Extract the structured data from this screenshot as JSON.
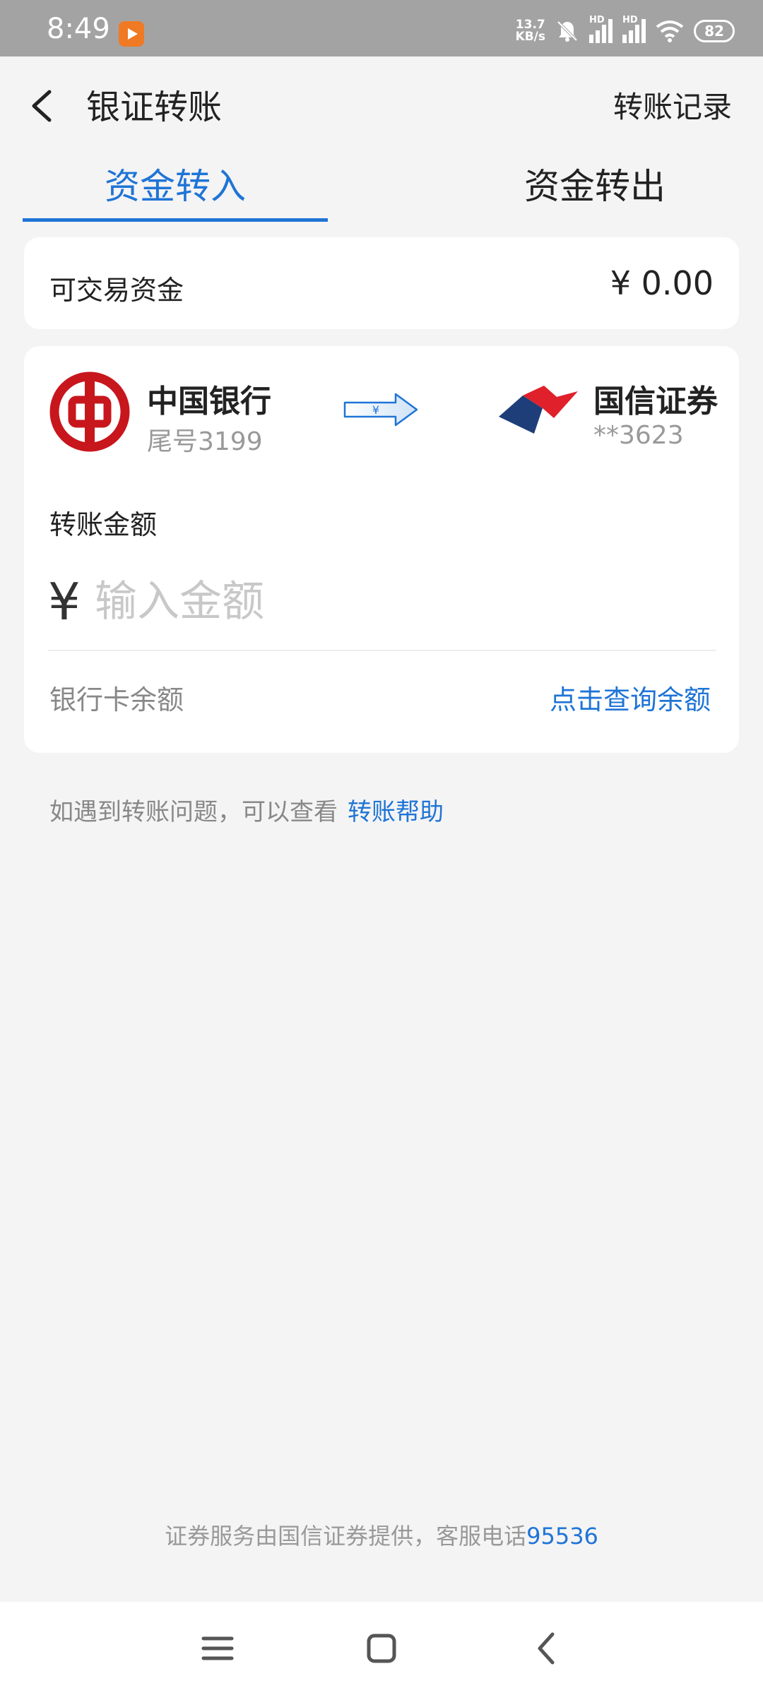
{
  "status_bar": {
    "time": "8:49",
    "net_speed_top": "13.7",
    "net_speed_bottom": "KB/s",
    "signal1_label": "HD",
    "signal2_label": "HD",
    "battery": "82"
  },
  "header": {
    "title": "银证转账",
    "history": "转账记录"
  },
  "tabs": [
    {
      "label": "资金转入",
      "active": true
    },
    {
      "label": "资金转出",
      "active": false
    }
  ],
  "funds": {
    "label": "可交易资金",
    "value": "¥ 0.00"
  },
  "transfer": {
    "from_bank": "中国银行",
    "from_tail": "尾号3199",
    "arrow_symbol": "¥",
    "to_broker": "国信证券",
    "to_account": "**3623",
    "amount_label": "转账金额",
    "currency_symbol": "¥",
    "amount_placeholder": "输入金额",
    "balance_label": "银行卡余额",
    "balance_link": "点击查询余额"
  },
  "help": {
    "text": "如遇到转账问题，可以查看",
    "link": "转账帮助"
  },
  "footer": {
    "text": "证券服务由国信证券提供，客服电话",
    "phone": "95536"
  },
  "colors": {
    "accent": "#1f74d6",
    "boc_red": "#c8161d",
    "broker_red": "#e0202a",
    "broker_blue": "#1e3e7a"
  }
}
